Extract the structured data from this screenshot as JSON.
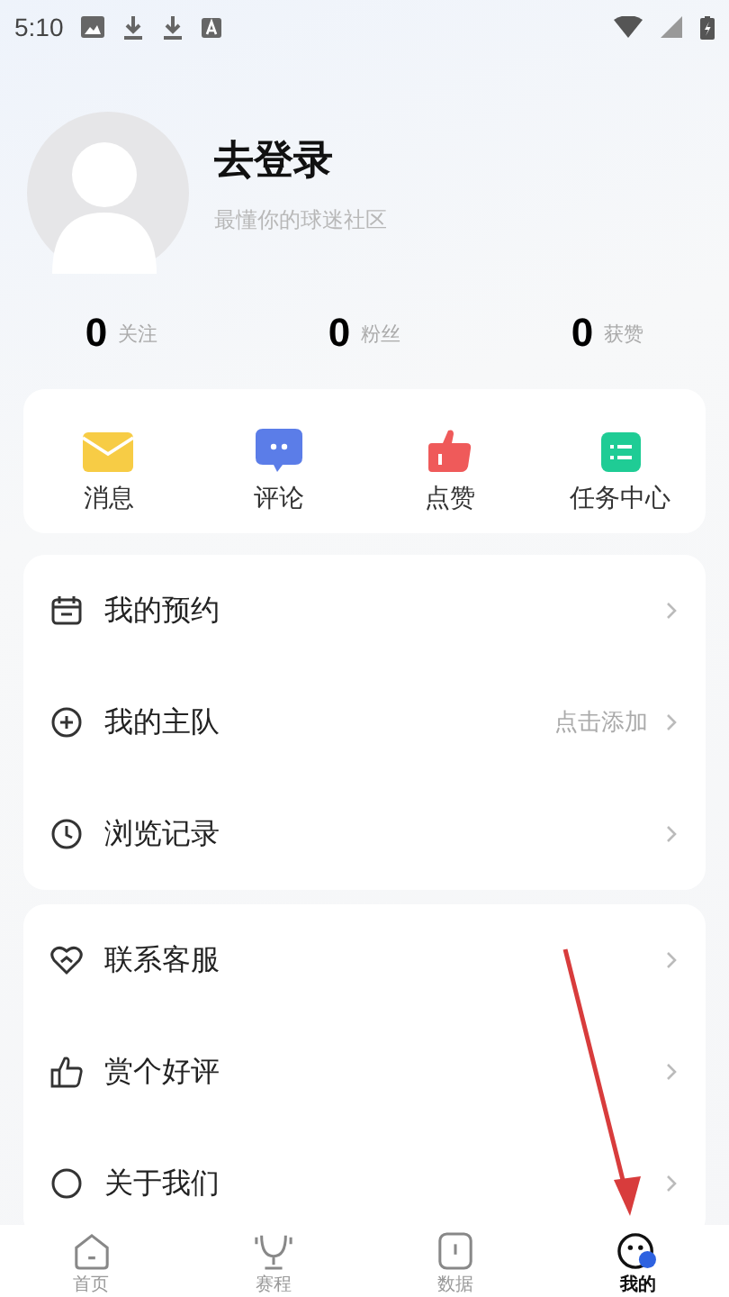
{
  "status_bar": {
    "time": "5:10"
  },
  "profile": {
    "name": "去登录",
    "tagline": "最懂你的球迷社区"
  },
  "stats": [
    {
      "value": "0",
      "label": "关注"
    },
    {
      "value": "0",
      "label": "粉丝"
    },
    {
      "value": "0",
      "label": "获赞"
    }
  ],
  "shortcuts": [
    {
      "kind": "mail",
      "label": "消息"
    },
    {
      "kind": "comment",
      "label": "评论"
    },
    {
      "kind": "like",
      "label": "点赞"
    },
    {
      "kind": "tasks",
      "label": "任务中心"
    }
  ],
  "menu_groups": [
    [
      {
        "kind": "calendar",
        "label": "我的预约"
      },
      {
        "kind": "add",
        "label": "我的主队",
        "hint": "点击添加"
      },
      {
        "kind": "clock",
        "label": "浏览记录"
      }
    ],
    [
      {
        "kind": "service",
        "label": "联系客服"
      },
      {
        "kind": "thumb",
        "label": "赏个好评"
      },
      {
        "kind": "info",
        "label": "关于我们"
      }
    ]
  ],
  "tab_bar": [
    {
      "kind": "home",
      "label": "首页",
      "selected": false
    },
    {
      "kind": "trophy",
      "label": "赛程",
      "selected": false
    },
    {
      "kind": "data",
      "label": "数据",
      "selected": false
    },
    {
      "kind": "me",
      "label": "我的",
      "selected": true
    }
  ]
}
